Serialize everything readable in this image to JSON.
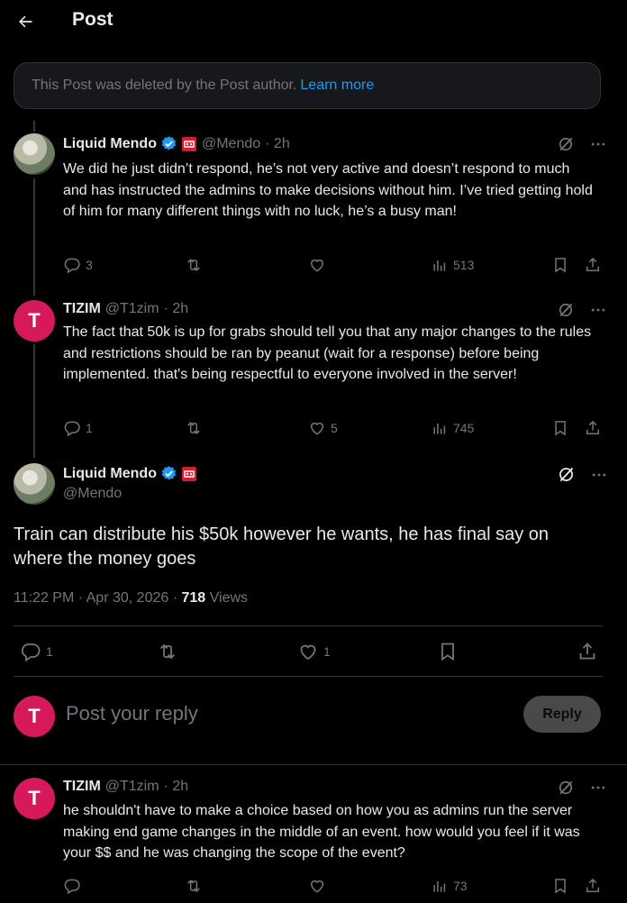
{
  "header": {
    "title": "Post"
  },
  "deleted_notice": {
    "text": "This Post was deleted by the Post author.",
    "link": "Learn more"
  },
  "tweets": [
    {
      "name": "Liquid Mendo",
      "handle": "@Mendo",
      "time": "· 2h",
      "text": "We did he just didn’t respond, he’s not very active and doesn’t respond to much and has instructed the admins to make decisions without him. I’ve tried getting hold of him for many different things with no luck, he’s a busy man!",
      "replies": "3",
      "reposts": "",
      "likes": "",
      "views": "513"
    },
    {
      "name": "TIZIM",
      "handle": "@T1zim",
      "time": "· 2h",
      "avatar_letter": "T",
      "text": "The fact that 50k is up for grabs should tell you that any major changes to the rules and restrictions should be ran by peanut (wait for a response) before being implemented. that's being respectful to everyone involved in the server!",
      "replies": "1",
      "reposts": "",
      "likes": "5",
      "views": "745"
    }
  ],
  "focus": {
    "name": "Liquid Mendo",
    "handle": "@Mendo",
    "text": "Train can distribute his $50k however he wants, he has final say on where the money goes",
    "timestamp": "11:22 PM · Apr 30, 2026 · ",
    "views_count": "718",
    "views_label": " Views",
    "replies": "1",
    "likes": "1"
  },
  "compose": {
    "avatar_letter": "T",
    "placeholder": "Post your reply",
    "button": "Reply"
  },
  "reply_tweet": {
    "name": "TIZIM",
    "handle": "@T1zim",
    "time": "· 2h",
    "avatar_letter": "T",
    "text": "he shouldn't have to make a choice based on how you as admins run the server making end game changes in the middle of an event. how would you feel if it was your $$ and he was changing the scope of the event?",
    "views": "73"
  },
  "colors": {
    "accent": "#1d9bf0",
    "avatar_pink": "#d6195b",
    "muted": "#71767b",
    "text": "#e7e9ea"
  }
}
